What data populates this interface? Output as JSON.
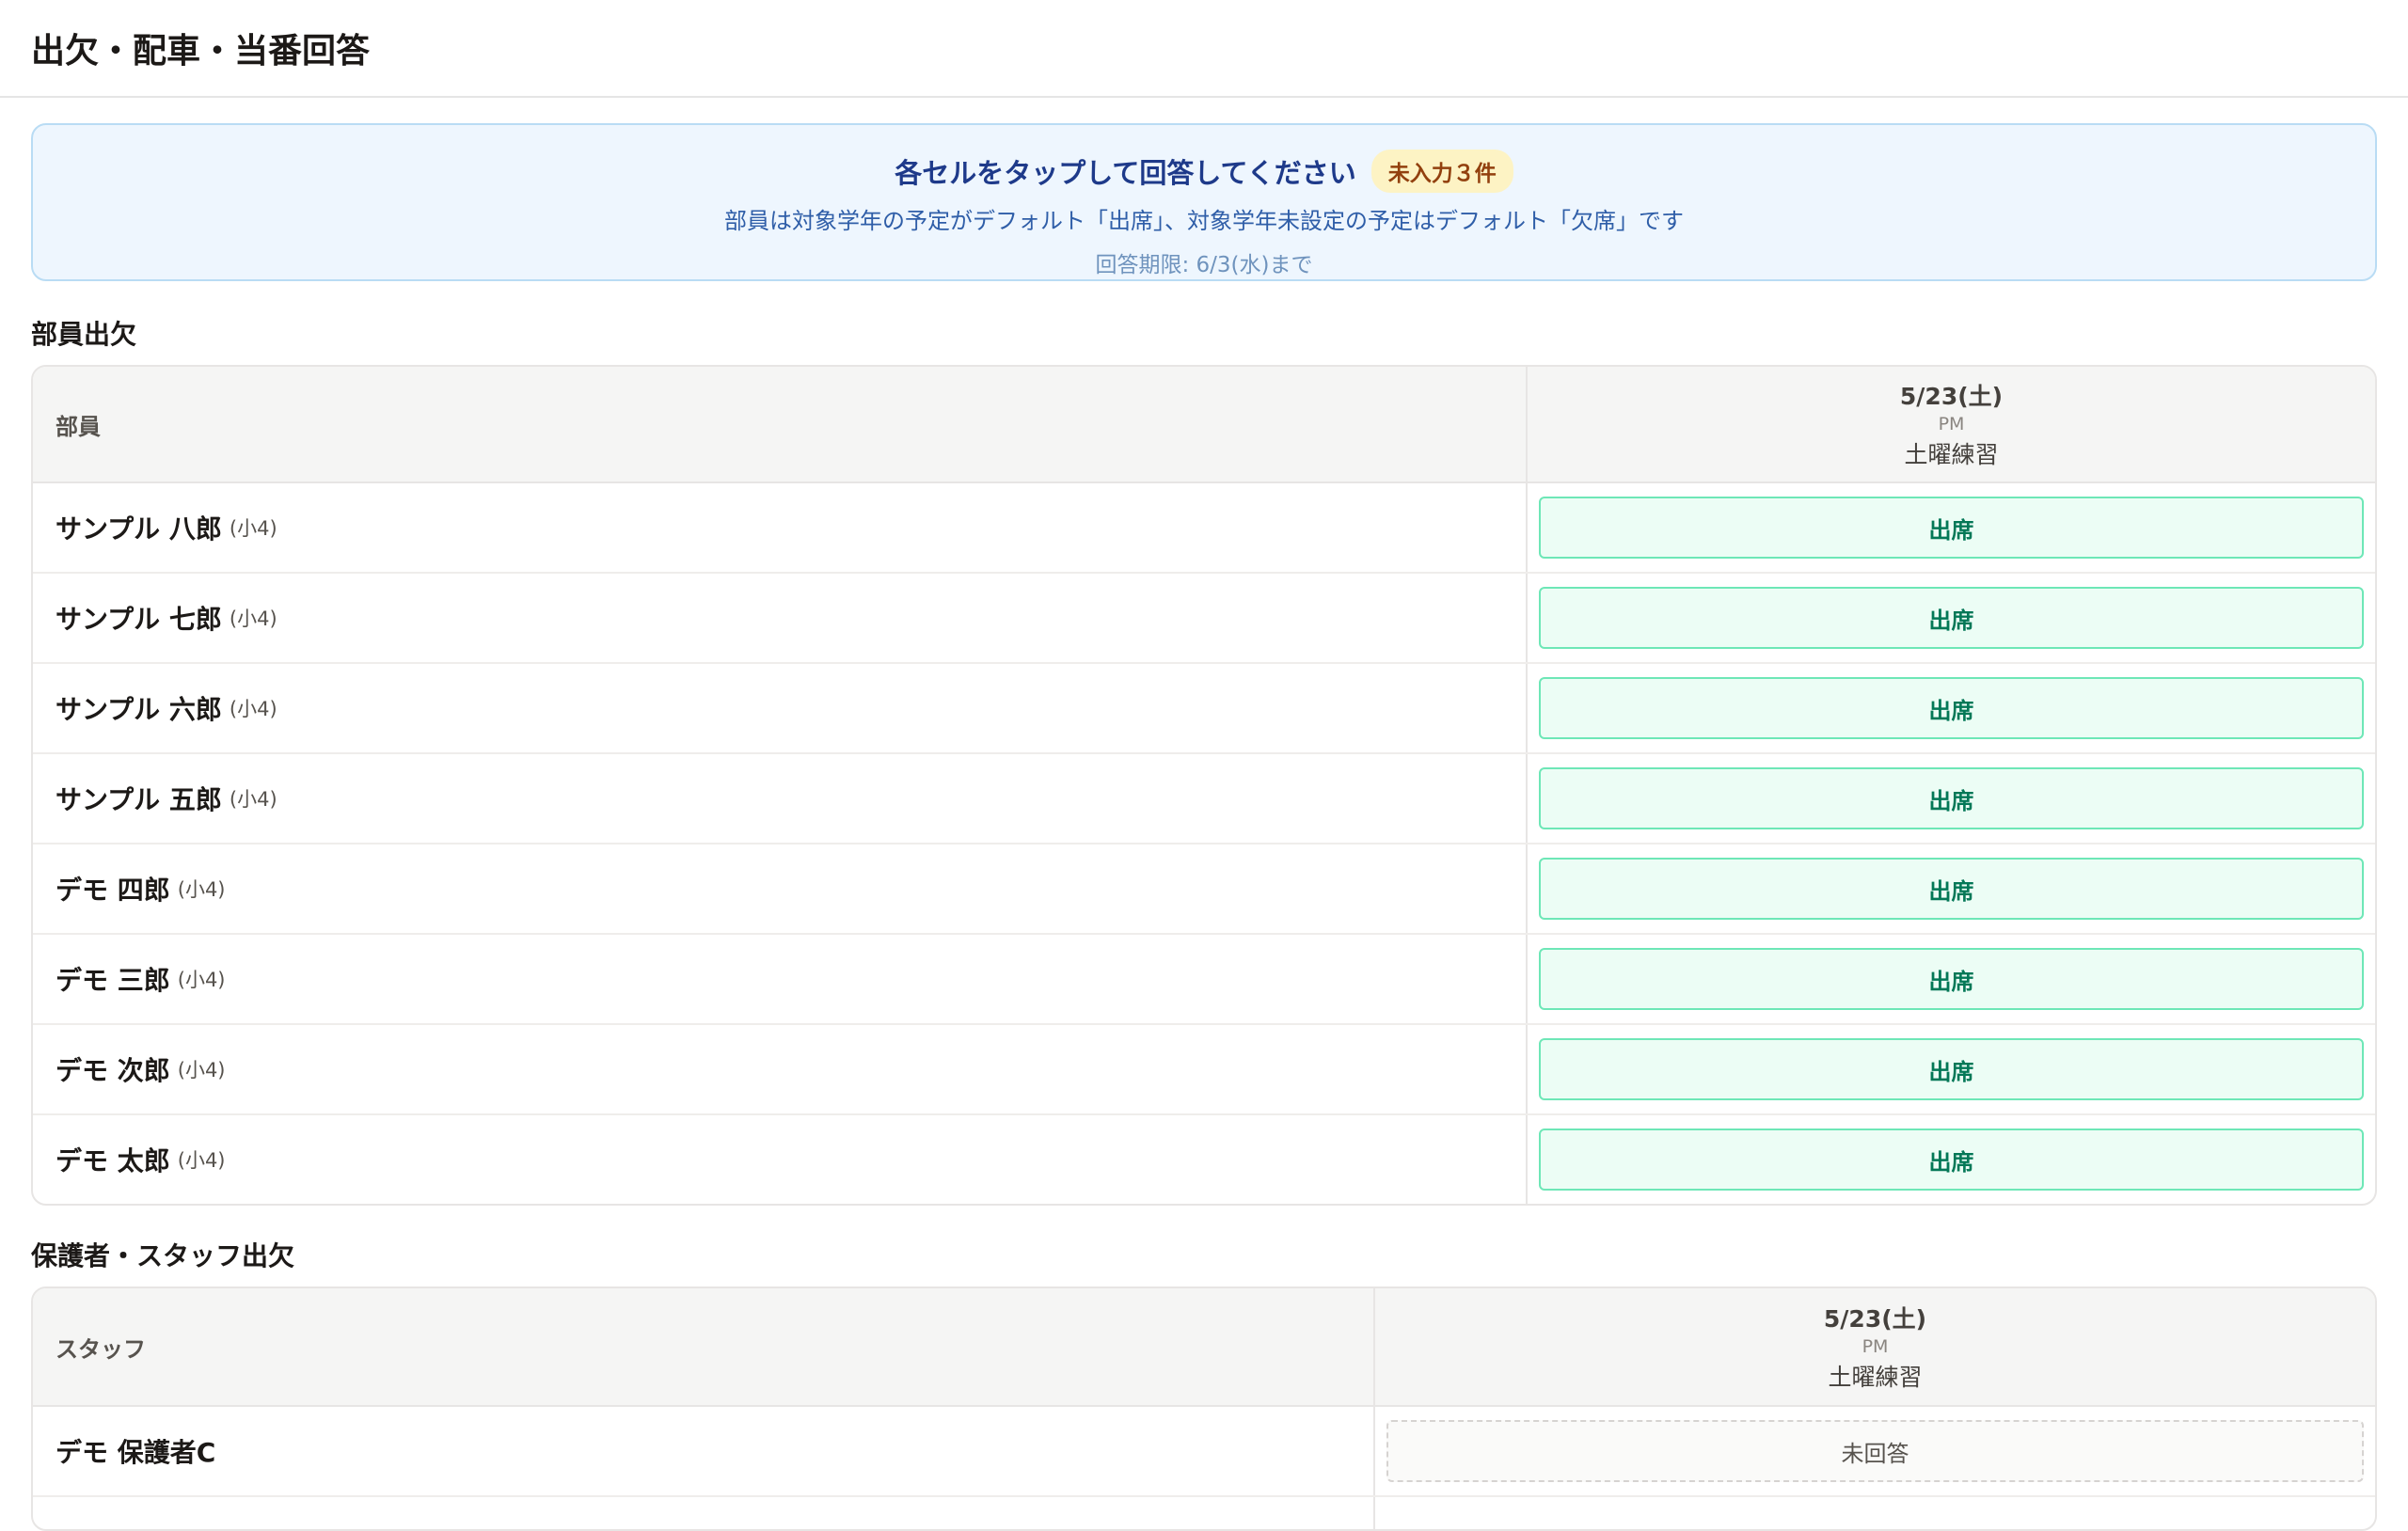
{
  "page": {
    "title": "出欠・配車・当番回答"
  },
  "notice": {
    "title": "各セルをタップして回答してください",
    "badge": "未入力３件",
    "subtitle": "部員は対象学年の予定がデフォルト「出席」、対象学年未設定の予定はデフォルト「欠席」です",
    "deadline": "回答期限: 6/3(水)まで"
  },
  "members_section": {
    "title": "部員出欠",
    "column_header": "部員",
    "event": {
      "date": "5/23(土)",
      "period": "PM",
      "name": "土曜練習"
    },
    "rows": [
      {
        "name": "サンプル 八郎",
        "grade": "(小4)",
        "status": "出席"
      },
      {
        "name": "サンプル 七郎",
        "grade": "(小4)",
        "status": "出席"
      },
      {
        "name": "サンプル 六郎",
        "grade": "(小4)",
        "status": "出席"
      },
      {
        "name": "サンプル 五郎",
        "grade": "(小4)",
        "status": "出席"
      },
      {
        "name": "デモ 四郎",
        "grade": "(小4)",
        "status": "出席"
      },
      {
        "name": "デモ 三郎",
        "grade": "(小4)",
        "status": "出席"
      },
      {
        "name": "デモ 次郎",
        "grade": "(小4)",
        "status": "出席"
      },
      {
        "name": "デモ 太郎",
        "grade": "(小4)",
        "status": "出席"
      }
    ]
  },
  "staff_section": {
    "title": "保護者・スタッフ出欠",
    "column_header": "スタッフ",
    "event": {
      "date": "5/23(土)",
      "period": "PM",
      "name": "土曜練習"
    },
    "rows": [
      {
        "name": "デモ 保護者C",
        "status": "未回答"
      }
    ]
  }
}
